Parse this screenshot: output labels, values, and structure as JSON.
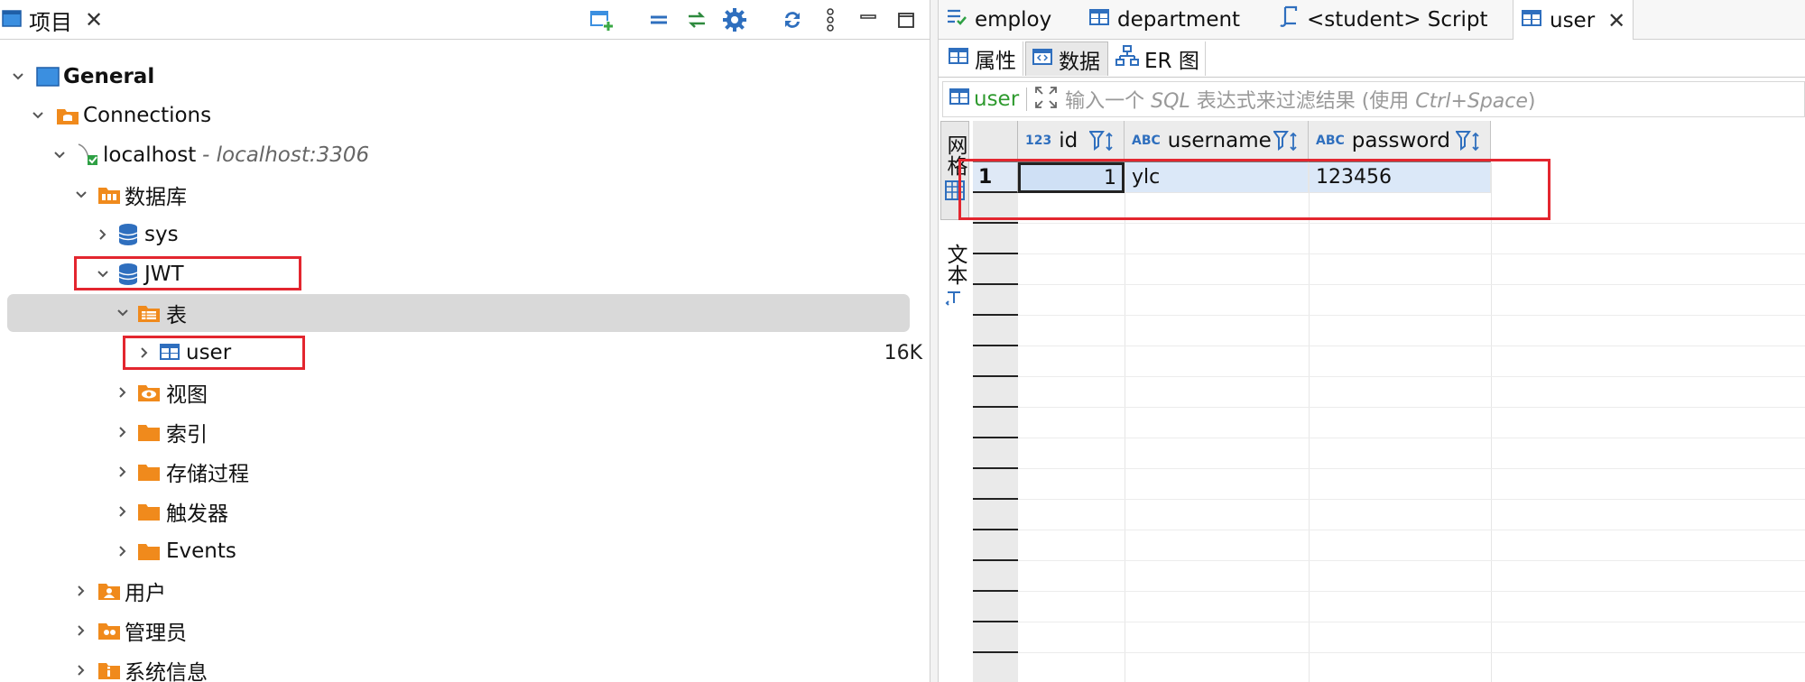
{
  "left_panel": {
    "tab_label": "项目",
    "tree": {
      "general": "General",
      "connections": "Connections",
      "localhost": "localhost",
      "localhost_detail": "- localhost:3306",
      "databases": "数据库",
      "sys": "sys",
      "jwt": "JWT",
      "tables": "表",
      "user": "user",
      "user_size": "16K",
      "views": "视图",
      "indexes": "索引",
      "procedures": "存储过程",
      "triggers": "触发器",
      "events": "Events",
      "users": "用户",
      "admins": "管理员",
      "sysinfo": "系统信息"
    }
  },
  "editor": {
    "tabs": [
      {
        "label": "employ"
      },
      {
        "label": "department"
      },
      {
        "label": "<student> Script"
      },
      {
        "label": "user"
      }
    ],
    "subtabs": {
      "properties": "属性",
      "data": "数据",
      "er": "ER 图"
    },
    "filter": {
      "table": "user",
      "placeholder_a": "输入一个 ",
      "placeholder_b": "SQL",
      "placeholder_c": " 表达式来过滤结果 (使用 ",
      "placeholder_d": "Ctrl+Space",
      "placeholder_e": ")"
    },
    "vtabs": {
      "grid": "网格",
      "text": "文本"
    },
    "grid": {
      "columns": [
        {
          "type": "123",
          "name": "id"
        },
        {
          "type": "ABC",
          "name": "username"
        },
        {
          "type": "ABC",
          "name": "password"
        }
      ],
      "rows": [
        {
          "num": "1",
          "id": "1",
          "username": "ylc",
          "password": "123456"
        }
      ]
    }
  },
  "colors": {
    "accent": "#2f6fbe",
    "folder": "#f08a1c",
    "highlight": "#e3262f"
  }
}
